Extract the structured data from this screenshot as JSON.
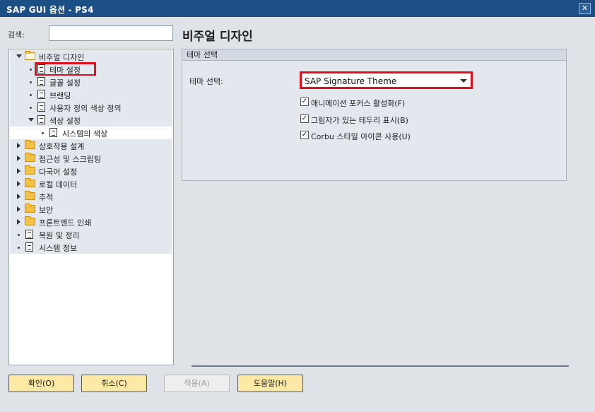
{
  "window": {
    "title": "SAP GUI 옵션 - PS4",
    "close_glyph": "✕"
  },
  "search": {
    "label": "검색:",
    "value": "",
    "placeholder": ""
  },
  "page_title": "비주얼 디자인",
  "tree": [
    {
      "label": "비주얼 디자인",
      "icon": "folder-open-icon",
      "expander": "expanded"
    },
    {
      "label": "테마 설정",
      "icon": "document-icon",
      "selected": true
    },
    {
      "label": "글꼴 설정",
      "icon": "document-icon"
    },
    {
      "label": "브랜딩",
      "icon": "document-icon"
    },
    {
      "label": "사용자 정의 색상 정의",
      "icon": "document-icon"
    },
    {
      "label": "색상 설정",
      "icon": "document-icon",
      "expander": "expanded"
    },
    {
      "label": "시스템의 색상",
      "icon": "document-icon"
    },
    {
      "label": "상호작용 설계",
      "icon": "folder-icon",
      "expander": "collapsed"
    },
    {
      "label": "접근성 및 스크립팅",
      "icon": "folder-icon",
      "expander": "collapsed"
    },
    {
      "label": "다국어 설정",
      "icon": "folder-icon",
      "expander": "collapsed"
    },
    {
      "label": "로컬 데이터",
      "icon": "folder-icon",
      "expander": "collapsed"
    },
    {
      "label": "추적",
      "icon": "folder-icon",
      "expander": "collapsed"
    },
    {
      "label": "보안",
      "icon": "folder-icon",
      "expander": "collapsed"
    },
    {
      "label": "프론트엔드 인쇄",
      "icon": "folder-icon",
      "expander": "collapsed"
    },
    {
      "label": "복원 및 정리",
      "icon": "document-icon"
    },
    {
      "label": "시스템 정보",
      "icon": "document-icon"
    }
  ],
  "panel": {
    "header": "테마 선택",
    "theme_label": "테마 선택:",
    "theme_value": "SAP Signature Theme",
    "checkboxes": [
      {
        "label": "애니메이션 포커스 활성화(F)",
        "checked": true
      },
      {
        "label": "그림자가 있는 테두리 표시(B)",
        "checked": true
      },
      {
        "label": "Corbu 스타일 아이콘 사용(U)",
        "checked": true
      }
    ]
  },
  "buttons": {
    "ok": "확인(O)",
    "cancel": "취소(C)",
    "apply": "적용(A)",
    "help": "도움말(H)"
  },
  "colors": {
    "titlebar": "#1c4f86",
    "highlight": "#e0101a",
    "button": "#fde9a6"
  }
}
